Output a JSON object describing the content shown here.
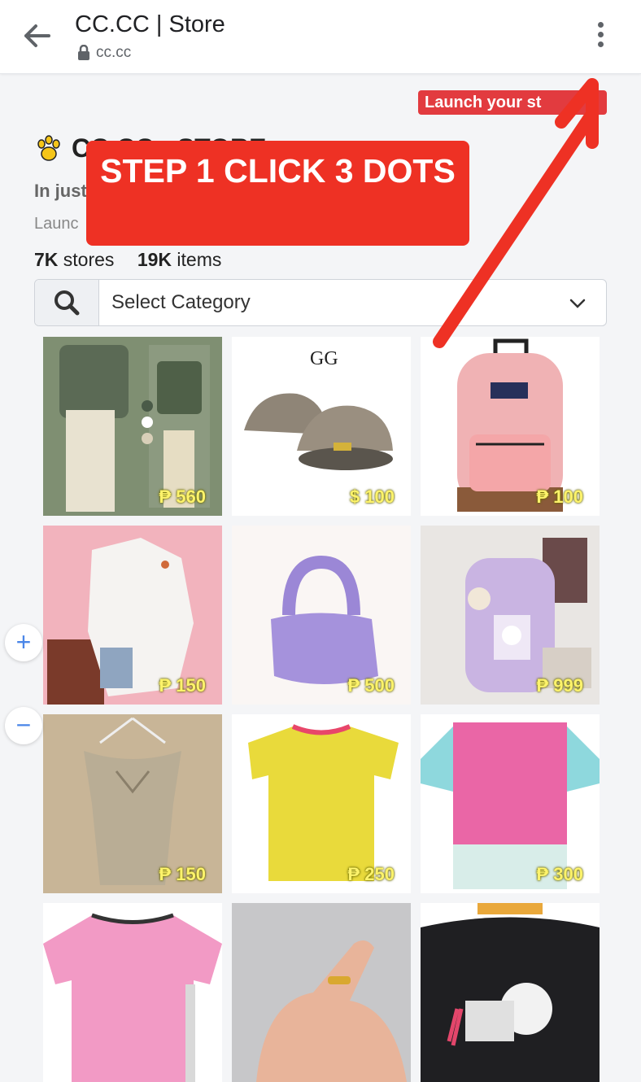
{
  "browser": {
    "title": "CC.CC | Store",
    "url": "cc.cc",
    "back_icon": "arrow-left-icon",
    "menu_icon": "vertical-dots-icon"
  },
  "page": {
    "launch_button": "Launch your st",
    "store_name": "CC.CC - STORE",
    "tagline": "In just",
    "launch_text": "Launc",
    "stats": {
      "stores_count": "7K",
      "stores_label": "stores",
      "items_count": "19K",
      "items_label": "items"
    },
    "category_select": {
      "placeholder": "Select Category"
    }
  },
  "products": [
    {
      "price": "₱ 560",
      "item": "green-jacket-outfit"
    },
    {
      "price": "$ 100",
      "item": "snakeskin-caps"
    },
    {
      "price": "₱ 100",
      "item": "pink-backpack"
    },
    {
      "price": "₱ 150",
      "item": "white-oversized-tee"
    },
    {
      "price": "₱ 500",
      "item": "purple-handbag"
    },
    {
      "price": "₱ 999",
      "item": "lavender-backpack"
    },
    {
      "price": "₱ 150",
      "item": "khaki-dress"
    },
    {
      "price": "₱ 250",
      "item": "yellow-tee"
    },
    {
      "price": "₱ 300",
      "item": "pink-colorblock-tee"
    },
    {
      "price": "",
      "item": "pink-tee"
    },
    {
      "price": "",
      "item": "gold-ring"
    },
    {
      "price": "",
      "item": "astronaut-tee"
    }
  ],
  "zoom_controls": {
    "zoom_in": "+",
    "zoom_out": "−"
  },
  "annotation": {
    "callout_text": "STEP 1 CLICK 3 DOTS",
    "color": "#ee3124"
  }
}
